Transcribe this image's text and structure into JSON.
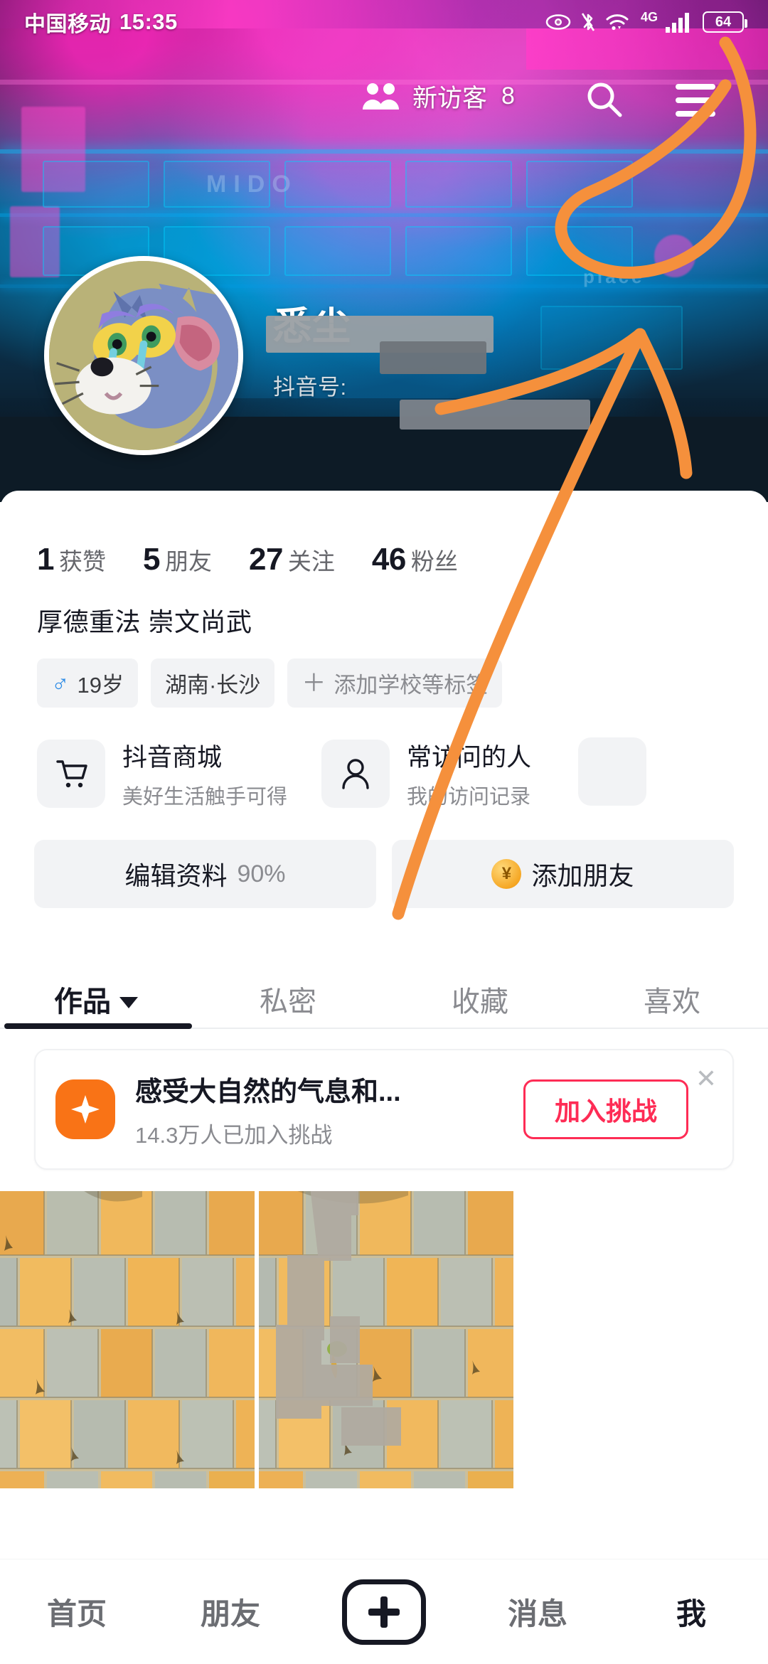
{
  "status_bar": {
    "carrier": "中国移动",
    "time": "15:35",
    "icons": [
      "eye-icon",
      "bluetooth-off-icon",
      "wifi-icon",
      "signal-4g-icon"
    ],
    "network": "4G",
    "battery": "64"
  },
  "top_nav": {
    "visitors_icon": "people-icon",
    "visitors_label": "新访客",
    "visitors_count": "8",
    "search_icon": "search-icon",
    "menu_icon": "hamburger-menu-icon"
  },
  "profile": {
    "avatar_alt": "cartoon-cat-avatar",
    "username": "悉尘",
    "username_redacted": true,
    "douyin_id_label": "抖音号:",
    "douyin_id_value": ""
  },
  "stats": [
    {
      "num": "1",
      "label": "获赞"
    },
    {
      "num": "5",
      "label": "朋友"
    },
    {
      "num": "27",
      "label": "关注"
    },
    {
      "num": "46",
      "label": "粉丝"
    }
  ],
  "bio": "厚德重法 崇文尚武",
  "tags": [
    {
      "icon": "male-icon",
      "label": "19岁"
    },
    {
      "icon": "",
      "label": "湖南·长沙"
    },
    {
      "icon": "plus-icon",
      "label": "添加学校等标签"
    }
  ],
  "shortcuts": [
    {
      "icon": "shopping-cart-icon",
      "title": "抖音商城",
      "subtitle": "美好生活触手可得"
    },
    {
      "icon": "person-icon",
      "title": "常访问的人",
      "subtitle": "我的访问记录"
    }
  ],
  "actions": {
    "edit_profile_label": "编辑资料",
    "edit_profile_percent": "90%",
    "add_friend_label": "添加朋友",
    "add_friend_icon": "coin-yen-icon"
  },
  "tabs": [
    {
      "label": "作品",
      "active": true,
      "has_caret": true
    },
    {
      "label": "私密",
      "active": false,
      "has_caret": false
    },
    {
      "label": "收藏",
      "active": false,
      "has_caret": false
    },
    {
      "label": "喜欢",
      "active": false,
      "has_caret": false
    }
  ],
  "challenge": {
    "icon": "sparkle-badge-icon",
    "title": "感受大自然的气息和...",
    "subtitle": "14.3万人已加入挑战",
    "button_label": "加入挑战",
    "close_icon": "close-icon",
    "accent_color": "#fe2c55"
  },
  "videos": [
    {
      "alt": "tiled-pavement-thumbnail-1"
    },
    {
      "alt": "tiled-pavement-thumbnail-2"
    }
  ],
  "bottom_nav": [
    {
      "label": "首页",
      "active": false
    },
    {
      "label": "朋友",
      "active": false
    },
    {
      "label": "",
      "active": false,
      "icon": "plus-create-icon"
    },
    {
      "label": "消息",
      "active": false
    },
    {
      "label": "我",
      "active": true
    }
  ],
  "annotation": {
    "color": "#f5903c",
    "shape": "circle-and-arrow pointing at hamburger-menu-icon"
  }
}
